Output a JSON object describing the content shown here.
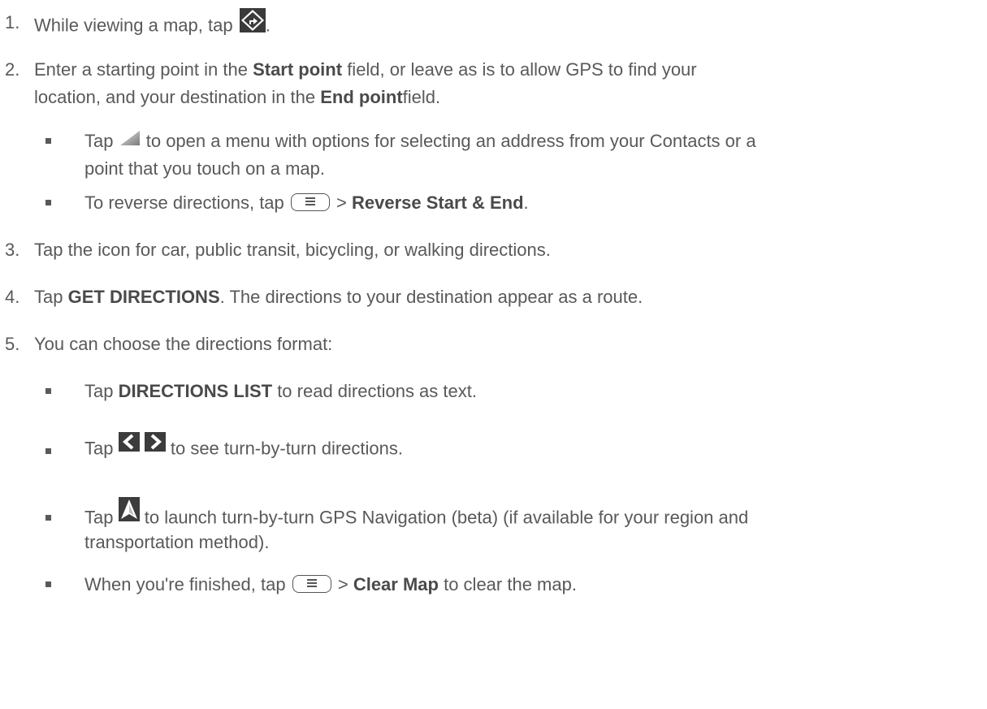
{
  "steps": [
    {
      "num": "1.",
      "lines": [
        {
          "before": "While viewing a map, tap",
          "after": "."
        }
      ]
    },
    {
      "num": "2.",
      "l1_a": "Enter a starting point in the",
      "l1_b": "Start point",
      "l1_c": "field, or leave as is to allow GPS to find your",
      "l2_a": "location, and your destination in the",
      "l2_b": "End point",
      "l2_c": "field.",
      "sub": [
        {
          "l1_a": "Tap",
          "l1_b": "to open a menu with options for selecting an address from your Contacts or a",
          "l2": "point that you touch on a map."
        },
        {
          "a": "To reverse directions, tap",
          "b": ">",
          "c": "Reverse Start & End",
          "d": "."
        }
      ]
    },
    {
      "num": "3.",
      "text": "Tap the icon for car, public transit, bicycling, or walking directions."
    },
    {
      "num": "4.",
      "a": "Tap",
      "b": "GET DIRECTIONS",
      "c": ". The directions to your destination appear as a route."
    },
    {
      "num": "5.",
      "text": "You can choose the directions format:",
      "sub": [
        {
          "a": "Tap",
          "b": "DIRECTIONS LIST",
          "c": "to read directions as text."
        },
        {
          "a": "Tap",
          "b": "to see turn-by-turn directions."
        },
        {
          "a": "Tap",
          "b": "to launch turn-by-turn GPS Navigation (beta) (if available for your region and",
          "l2": "transportation method)."
        },
        {
          "a": "When you're finished, tap",
          "b": ">",
          "c": "Clear Map",
          "d": "to clear the map."
        }
      ]
    }
  ],
  "icons": {
    "directions": "directions-diamond-icon",
    "dropdown": "dropdown-triangle-icon",
    "menu": "menu-key-icon",
    "prev": "previous-arrow-icon",
    "next": "next-arrow-icon",
    "navigation": "navigation-arrow-icon"
  }
}
